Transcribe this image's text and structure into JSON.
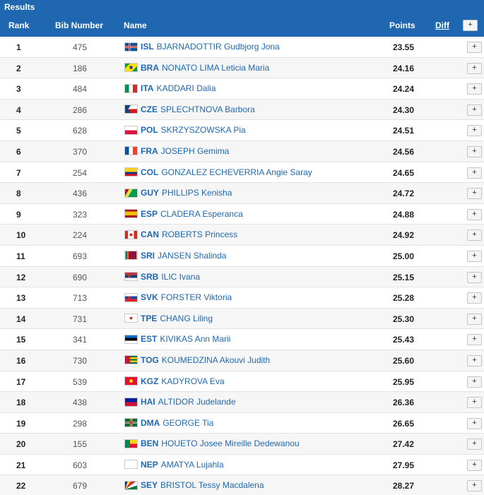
{
  "title": "Results",
  "columns": {
    "rank": "Rank",
    "bib": "Bib Number",
    "name": "Name",
    "points": "Points",
    "diff": "Diff",
    "expand": "+"
  },
  "rows": [
    {
      "rank": "1",
      "bib": "475",
      "code": "ISL",
      "name": "BJARNADOTTIR Gudbjorg Jona",
      "points": "23.55",
      "flag_bg": "linear-gradient(90deg, transparent 28%, #fff 28%, #fff 33%, #d72828 33%, #d72828 40%, #fff 40%, #fff 45%, transparent 45%), linear-gradient(180deg, #02529c 36%, #fff 36%, #fff 43%, #d72828 43%, #d72828 57%, #fff 57%, #fff 64%, #02529c 64%)"
    },
    {
      "rank": "2",
      "bib": "186",
      "code": "BRA",
      "name": "NONATO LIMA Leticia Maria",
      "points": "24.16",
      "flag_bg": "radial-gradient(circle at 50% 50%, #2a3b8f 0 22%, transparent 23%), linear-gradient(135deg, #009c3b 25%, #ffdf00 25%, #ffdf00 75%, #009c3b 75%)"
    },
    {
      "rank": "3",
      "bib": "484",
      "code": "ITA",
      "name": "KADDARI Dalia",
      "points": "24.24",
      "flag_bg": "linear-gradient(90deg, #009246 33%, #fff 33%, #fff 66%, #ce2b37 66%)"
    },
    {
      "rank": "4",
      "bib": "286",
      "code": "CZE",
      "name": "SPLECHTNOVA Barbora",
      "points": "24.30",
      "flag_bg": "linear-gradient(124deg, #11457e 33%, transparent 33%), linear-gradient(56deg, #11457e 33%, transparent 33%), linear-gradient(180deg, #fff 50%, #d7141a 50%)"
    },
    {
      "rank": "5",
      "bib": "628",
      "code": "POL",
      "name": "SKRZYSZOWSKA Pia",
      "points": "24.51",
      "flag_bg": "linear-gradient(180deg, #fff 50%, #dc143c 50%)"
    },
    {
      "rank": "6",
      "bib": "370",
      "code": "FRA",
      "name": "JOSEPH Gemima",
      "points": "24.56",
      "flag_bg": "linear-gradient(90deg, #0055a4 33%, #fff 33%, #fff 66%, #ef4135 66%)"
    },
    {
      "rank": "7",
      "bib": "254",
      "code": "COL",
      "name": "GONZALEZ ECHEVERRIA Angie Saray",
      "points": "24.65",
      "flag_bg": "linear-gradient(180deg, #fcd116 50%, #003893 50%, #003893 75%, #ce1126 75%)"
    },
    {
      "rank": "8",
      "bib": "436",
      "code": "GUY",
      "name": "PHILLIPS Kenisha",
      "points": "24.72",
      "flag_bg": "linear-gradient(120deg, #ce1126 18%, #000 18%, #000 22%, #fcd116 22%, #fcd116 40%, #fff 40%, #fff 44%, #009e49 44%)"
    },
    {
      "rank": "9",
      "bib": "323",
      "code": "ESP",
      "name": "CLADERA Esperanca",
      "points": "24.88",
      "flag_bg": "linear-gradient(180deg, #aa151b 25%, #f1bf00 25%, #f1bf00 75%, #aa151b 75%)"
    },
    {
      "rank": "10",
      "bib": "224",
      "code": "CAN",
      "name": "ROBERTS Princess",
      "points": "24.92",
      "flag_bg": "radial-gradient(circle at 50% 50%, #d52b1e 0 20%, transparent 22%), linear-gradient(90deg, #d52b1e 25%, #fff 25%, #fff 75%, #d52b1e 75%)"
    },
    {
      "rank": "11",
      "bib": "693",
      "code": "SRI",
      "name": "JANSEN Shalinda",
      "points": "25.00",
      "flag_bg": "linear-gradient(90deg, #ffb700 6%, #005f56 6%, #005f56 16%, #ff5b00 16%, #ff5b00 26%, #ffb700 26%, #ffb700 30%, #8d153a 30%, #8d153a 94%, #ffb700 94%)"
    },
    {
      "rank": "12",
      "bib": "690",
      "code": "SRB",
      "name": "ILIC Ivana",
      "points": "25.15",
      "flag_bg": "radial-gradient(circle at 35% 50%, #c6363c 0 14%, transparent 16%), linear-gradient(180deg, #c6363c 33%, #0c4076 33%, #0c4076 66%, #fff 66%)"
    },
    {
      "rank": "13",
      "bib": "713",
      "code": "SVK",
      "name": "FORSTER Viktoria",
      "points": "25.28",
      "flag_bg": "radial-gradient(circle at 35% 50%, #ee1c25 0 16%, transparent 18%), linear-gradient(180deg, #fff 33%, #0b4ea2 33%, #0b4ea2 66%, #ee1c25 66%)"
    },
    {
      "rank": "14",
      "bib": "731",
      "code": "TPE",
      "name": "CHANG Liling",
      "points": "25.30",
      "flag_bg": "radial-gradient(circle at 50% 50%, #d22 0 18%, #fff 19% 30%, transparent 31%), linear-gradient(#fff, #fff)"
    },
    {
      "rank": "15",
      "bib": "341",
      "code": "EST",
      "name": "KIVIKAS Ann Marii",
      "points": "25.43",
      "flag_bg": "linear-gradient(180deg, #0072ce 33%, #000 33%, #000 66%, #fff 66%)"
    },
    {
      "rank": "16",
      "bib": "730",
      "code": "TOG",
      "name": "KOUMEDZINA Akouvi Judith",
      "points": "25.60",
      "flag_bg": "linear-gradient(90deg, #d21034 40%, transparent 40%), linear-gradient(180deg, #006a4e 20%, #ffce00 20%, #ffce00 40%, #006a4e 40%, #006a4e 60%, #ffce00 60%, #ffce00 80%, #006a4e 80%)"
    },
    {
      "rank": "17",
      "bib": "539",
      "code": "KGZ",
      "name": "KADYROVA Eva",
      "points": "25.95",
      "flag_bg": "radial-gradient(circle at 50% 50%, #ffef00 0 22%, transparent 24%), linear-gradient(#e8112d, #e8112d)"
    },
    {
      "rank": "18",
      "bib": "438",
      "code": "HAI",
      "name": "ALTIDOR Judelande",
      "points": "26.36",
      "flag_bg": "linear-gradient(180deg, #00209f 50%, #d21034 50%)"
    },
    {
      "rank": "19",
      "bib": "298",
      "code": "DMA",
      "name": "GEORGE Tia",
      "points": "26.65",
      "flag_bg": "radial-gradient(circle at 50% 50%, #d41c30 0 16%, transparent 18%), linear-gradient(90deg, transparent 40%, #fcd116 40%, #fcd116 46%, #000 46%, #000 52%, #fff 52%, #fff 58%, transparent 58%), linear-gradient(180deg, #006b3f 40%, #fcd116 40%, #fcd116 46%, #000 46%, #000 52%, #fff 52%, #fff 58%, #006b3f 58%)"
    },
    {
      "rank": "20",
      "bib": "155",
      "code": "BEN",
      "name": "HOUETO Josee Mireille Dedewanou",
      "points": "27.42",
      "flag_bg": "linear-gradient(90deg, #008751 40%, transparent 40%), linear-gradient(180deg, #fcd116 50%, #e8112d 50%)"
    },
    {
      "rank": "21",
      "bib": "603",
      "code": "NEP",
      "name": "AMATYA Lujahla",
      "points": "27.95",
      "flag_bg": "linear-gradient(125deg, #fff 0%, #fff 100%)"
    },
    {
      "rank": "22",
      "bib": "679",
      "code": "SEY",
      "name": "BRISTOL Tessy Macdalena",
      "points": "28.27",
      "flag_bg": "conic-gradient(from 0deg at 0% 100%, #003f87 0deg 18deg, #fcd856 18deg 36deg, #d62828 36deg 54deg, #fff 54deg 72deg, #007a3d 72deg 90deg)"
    }
  ],
  "colors": {
    "header_bg": "#1f68b1",
    "link": "#1f68b1",
    "row_alt": "#f6f6f6"
  }
}
